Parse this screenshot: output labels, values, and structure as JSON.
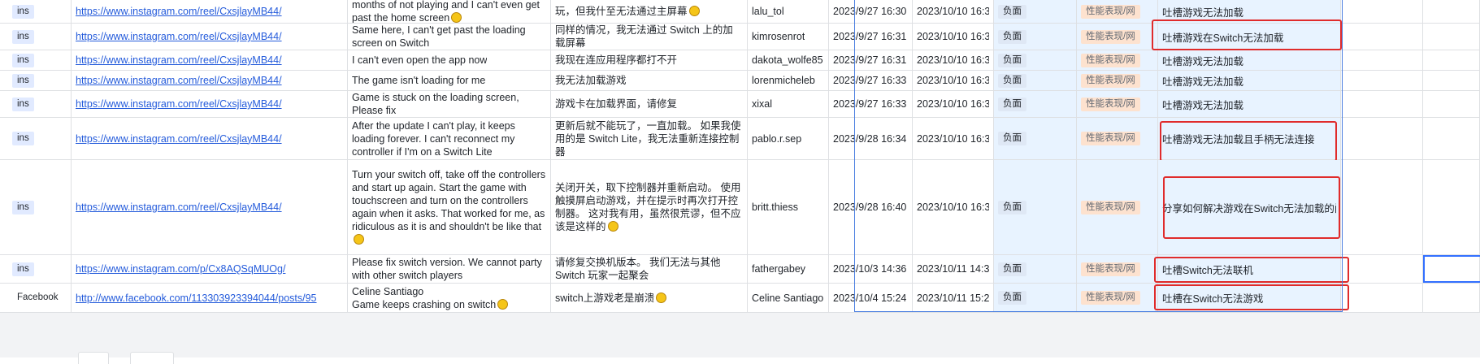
{
  "colors": {
    "accent": "#3370ff",
    "highlight_col": "#e8f3ff",
    "annotation_box": "#e02b2b",
    "link": "#245bdb"
  },
  "rows": [
    {
      "source": "ins",
      "link": "https://www.instagram.com/reel/CxsjlayMB44/",
      "comment": "months of not playing and I can't even get past the home screen",
      "comment_emoji": true,
      "translation": "玩，但我什至无法通过主屏幕",
      "translation_emoji": true,
      "user": "lalu_tol",
      "posted": "2023/9/27 16:30",
      "collected": "2023/10/10 16:3",
      "sentiment": "负面",
      "category": "性能表现/网",
      "summary": "吐槽游戏无法加载",
      "boxed": false
    },
    {
      "source": "ins",
      "link": "https://www.instagram.com/reel/CxsjlayMB44/",
      "comment": "Same here, I can't get past the loading screen on Switch",
      "comment_emoji": false,
      "translation": "同样的情况，我无法通过 Switch 上的加载屏幕",
      "translation_emoji": false,
      "user": "kimrosenrot",
      "posted": "2023/9/27 16:31",
      "collected": "2023/10/10 16:3",
      "sentiment": "负面",
      "category": "性能表现/网",
      "summary": "吐槽游戏在Switch无法加载",
      "boxed": true
    },
    {
      "source": "ins",
      "link": "https://www.instagram.com/reel/CxsjlayMB44/",
      "comment": "I can't even open the app now",
      "comment_emoji": false,
      "translation": "我现在连应用程序都打不开",
      "translation_emoji": false,
      "user": "dakota_wolfe85",
      "posted": "2023/9/27 16:31",
      "collected": "2023/10/10 16:3",
      "sentiment": "负面",
      "category": "性能表现/网",
      "summary": "吐槽游戏无法加载",
      "boxed": false
    },
    {
      "source": "ins",
      "link": "https://www.instagram.com/reel/CxsjlayMB44/",
      "comment": "The game isn't loading for me",
      "comment_emoji": false,
      "translation": "我无法加载游戏",
      "translation_emoji": false,
      "user": "lorenmicheleb",
      "posted": "2023/9/27 16:33",
      "collected": "2023/10/10 16:3",
      "sentiment": "负面",
      "category": "性能表现/网",
      "summary": "吐槽游戏无法加载",
      "boxed": false
    },
    {
      "source": "ins",
      "link": "https://www.instagram.com/reel/CxsjlayMB44/",
      "comment": "Game is stuck on the loading screen, Please fix",
      "comment_emoji": false,
      "translation": "游戏卡在加载界面，请修复",
      "translation_emoji": false,
      "user": "xixal",
      "posted": "2023/9/27 16:33",
      "collected": "2023/10/10 16:3",
      "sentiment": "负面",
      "category": "性能表现/网",
      "summary": "吐槽游戏无法加载",
      "boxed": false
    },
    {
      "source": "ins",
      "link": "https://www.instagram.com/reel/CxsjlayMB44/",
      "comment": "After the update I can't play, it keeps loading forever. I can't reconnect my controller if I'm on a Switch Lite",
      "comment_emoji": false,
      "translation": "更新后就不能玩了，一直加载。 如果我使用的是 Switch Lite，我无法重新连接控制器",
      "translation_emoji": false,
      "user": "pablo.r.sep",
      "posted": "2023/9/28 16:34",
      "collected": "2023/10/10 16:3",
      "sentiment": "负面",
      "category": "性能表现/网",
      "summary": "吐槽游戏无法加载且手柄无法连接",
      "boxed": true
    },
    {
      "source": "ins",
      "link": "https://www.instagram.com/reel/CxsjlayMB44/",
      "comment": "Turn your switch off, take off the controllers and start up again. Start the game with touchscreen and turn on the controllers again when it asks. That worked for me, as ridiculous as it is and shouldn't be like that",
      "comment_emoji": true,
      "translation": "关闭开关，取下控制器并重新启动。 使用触摸屏启动游戏，并在提示时再次打开控制器。 这对我有用，虽然很荒谬，但不应该是这样的",
      "translation_emoji": true,
      "user": "britt.thiess",
      "posted": "2023/9/28 16:40",
      "collected": "2023/10/10 16:3",
      "sentiment": "负面",
      "category": "性能表现/网",
      "summary": "分享如何解决游戏在Switch无法加载的问题，顺便吐槽游戏",
      "boxed": true
    },
    {
      "source": "ins",
      "link": "https://www.instagram.com/p/Cx8AQSqMUOg/",
      "comment": "Please fix switch version. We cannot party with other switch players",
      "comment_emoji": false,
      "translation": "请修复交换机版本。 我们无法与其他 Switch 玩家一起聚会",
      "translation_emoji": false,
      "user": "fathergabey",
      "posted": "2023/10/3 14:36",
      "collected": "2023/10/11 14:3",
      "sentiment": "负面",
      "category": "性能表现/网",
      "summary": "吐槽Switch无法联机",
      "boxed": true
    },
    {
      "source": "Facebook",
      "link": "http://www.facebook.com/113303923394044/posts/95",
      "comment": "Celine Santiago\nGame keeps crashing on switch",
      "comment_emoji": true,
      "translation": "switch上游戏老是崩溃",
      "translation_emoji": true,
      "user": "Celine Santiago",
      "posted": "2023/10/4 15:24",
      "collected": "2023/10/11 15:2",
      "sentiment": "负面",
      "category": "性能表现/网",
      "summary": "吐槽在Switch无法游戏",
      "boxed": true
    }
  ]
}
